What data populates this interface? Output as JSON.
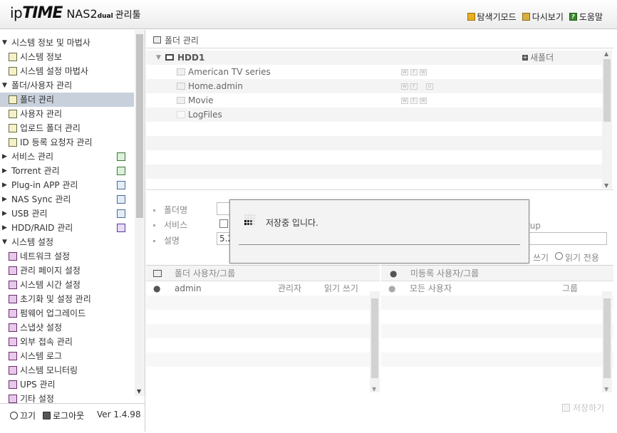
{
  "header": {
    "logo": {
      "ip": "ip",
      "time": "TIME",
      "nas": "NAS2",
      "dual": "dual",
      "tool": "관리툴"
    },
    "links": {
      "search_mode": "탐색기모드",
      "refresh": "다시보기",
      "help": "도움말"
    }
  },
  "sidebar": {
    "items": [
      {
        "label": "시스템 정보 및 마법사",
        "type": "section",
        "expanded": true
      },
      {
        "label": "시스템 정보",
        "type": "sub",
        "icon": "chart-icon"
      },
      {
        "label": "시스템 설정 마법사",
        "type": "sub",
        "icon": "chart-icon"
      },
      {
        "label": "폴더/사용자 관리",
        "type": "section",
        "expanded": true
      },
      {
        "label": "폴더 관리",
        "type": "sub",
        "icon": "folder-panel-icon",
        "active": true
      },
      {
        "label": "사용자 관리",
        "type": "sub",
        "icon": "user-panel-icon"
      },
      {
        "label": "업로드 폴더 관리",
        "type": "sub",
        "icon": "upload-folder-icon"
      },
      {
        "label": "ID 등록 요청자 관리",
        "type": "sub",
        "icon": "id-request-icon"
      },
      {
        "label": "서비스 관리",
        "type": "section",
        "expanded": false,
        "right_icon": "service-icon"
      },
      {
        "label": "Torrent 관리",
        "type": "section",
        "expanded": false,
        "right_icon": "torrent-icon"
      },
      {
        "label": "Plug-in APP 관리",
        "type": "section",
        "expanded": false,
        "right_icon": "plugin-icon"
      },
      {
        "label": "NAS Sync 관리",
        "type": "section",
        "expanded": false,
        "right_icon": "sync-icon"
      },
      {
        "label": "USB 관리",
        "type": "section",
        "expanded": false,
        "right_icon": "usb-icon"
      },
      {
        "label": "HDD/RAID 관리",
        "type": "section",
        "expanded": false,
        "right_icon": "hdd-icon"
      },
      {
        "label": "시스템 설정",
        "type": "section",
        "expanded": true
      },
      {
        "label": "네트워크 설정",
        "type": "sub",
        "icon": "network-icon",
        "pink": true
      },
      {
        "label": "관리 페이지 설정",
        "type": "sub",
        "icon": "admin-page-icon",
        "pink": true
      },
      {
        "label": "시스템 시간 설정",
        "type": "sub",
        "icon": "clock-icon",
        "pink": true
      },
      {
        "label": "초기화 및 설정 관리",
        "type": "sub",
        "icon": "reset-icon",
        "pink": true
      },
      {
        "label": "펌웨어 업그레이드",
        "type": "sub",
        "icon": "firmware-icon",
        "pink": true
      },
      {
        "label": "스냅샷 설정",
        "type": "sub",
        "icon": "snapshot-icon",
        "pink": true
      },
      {
        "label": "외부 접속 관리",
        "type": "sub",
        "icon": "remote-access-icon",
        "pink": true
      },
      {
        "label": "시스템 로그",
        "type": "sub",
        "icon": "log-icon",
        "pink": true
      },
      {
        "label": "시스템 모니터링",
        "type": "sub",
        "icon": "monitor-icon",
        "pink": true
      },
      {
        "label": "UPS 관리",
        "type": "sub",
        "icon": "ups-icon",
        "pink": true
      },
      {
        "label": "기타 설정",
        "type": "sub",
        "icon": "etc-icon",
        "pink": true
      }
    ],
    "footer": {
      "power": "끄기",
      "logout": "로그아웃",
      "version": "Ver 1.4.98"
    }
  },
  "main": {
    "title": "폴더 관리",
    "tree": {
      "disk": "HDD1",
      "new_folder": "새폴더",
      "folders": [
        "American TV series",
        "Home.admin",
        "Movie",
        "LogFiles"
      ]
    },
    "form": {
      "folder_name_label": "폴더명",
      "service_label": "서비스",
      "description_label": "설명",
      "description_value": "5.2",
      "backup_text": "tup",
      "read_write": "쓰기",
      "read_only": "읽기 전용"
    },
    "users_pane": {
      "title": "폴더 사용자/그룹",
      "rows": [
        {
          "name": "admin",
          "role": "관리자",
          "perm": "읽기 쓰기"
        }
      ]
    },
    "unreg_pane": {
      "title": "미등록 사용자/그룹",
      "rows": [
        {
          "name": "모든 사용자",
          "type": "그룹"
        }
      ]
    },
    "save_label": "저장하기"
  },
  "dialog": {
    "message": "저장중 입니다."
  }
}
